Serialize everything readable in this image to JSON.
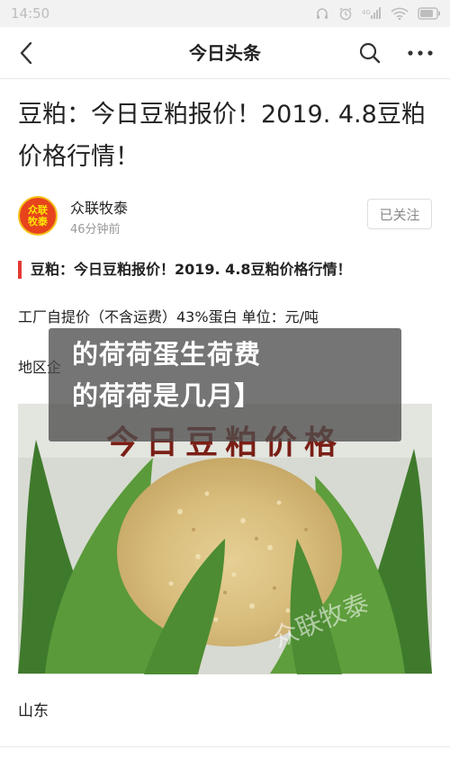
{
  "status_bar": {
    "time": "14:50",
    "icons": [
      "headphone-icon",
      "alarm-icon",
      "signal-icon",
      "wifi-icon",
      "battery-icon"
    ]
  },
  "nav": {
    "title": "今日头条",
    "back_icon": "back-arrow-icon",
    "search_icon": "search-icon",
    "more_icon": "more-icon"
  },
  "article": {
    "title": "豆粕：今日豆粕报价！2019. 4.8豆粕价格行情！",
    "author": {
      "name": "众联牧泰",
      "time": "46分钟前",
      "avatar_text": [
        "众联",
        "牧泰"
      ],
      "follow_label": "已关注"
    },
    "section_heading": "豆粕：今日豆粕报价！2019. 4.8豆粕价格行情！",
    "paragraph_1": "工厂自提价（不含运费）43%蛋白 单位：元/吨",
    "paragraph_2": "地区企",
    "image": {
      "caption_text": "今日豆粕价格",
      "watermark_text": "众联牧泰"
    },
    "location": "山东"
  },
  "overlay": {
    "line_1": "的荷荷蛋生荷费",
    "line_2": "的荷荷是几月】"
  },
  "colors": {
    "accent_red": "#e53935",
    "avatar_bg": "#e7431d",
    "avatar_text": "#ffe600"
  }
}
